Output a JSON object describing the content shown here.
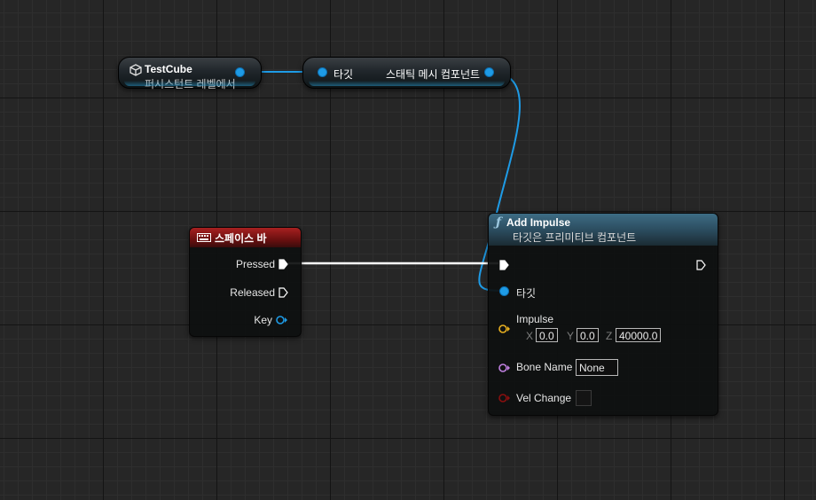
{
  "nodes": {
    "test_cube": {
      "title": "TestCube",
      "subtitle": "퍼시스턴트 레벨에서",
      "icon": "cube-icon"
    },
    "target_getter": {
      "input_label": "타깃",
      "output_label": "스태틱 메시 컴포넌트"
    },
    "space_bar": {
      "title": "스페이스 바",
      "icon": "keyboard-icon",
      "pins": {
        "pressed": "Pressed",
        "released": "Released",
        "key": "Key"
      }
    },
    "add_impulse": {
      "title": "Add Impulse",
      "subtitle": "타깃은 프리미티브 컴포넌트",
      "icon": "function-icon",
      "target_label": "타깃",
      "impulse_label": "Impulse",
      "x_label": "X",
      "x_value": "0.0",
      "y_label": "Y",
      "y_value": "0.0",
      "z_label": "Z",
      "z_value": "40000.0",
      "bone_name_label": "Bone Name",
      "bone_name_value": "None",
      "vel_change_label": "Vel Change",
      "vel_change_checked": false
    }
  },
  "colors": {
    "object_pin": "#1e9be6",
    "vector_pin": "#e8b020",
    "name_pin": "#c080e0",
    "bool_pin": "#8a0f0f",
    "event_header": "#a82020",
    "function_header": "#3d6c84"
  }
}
